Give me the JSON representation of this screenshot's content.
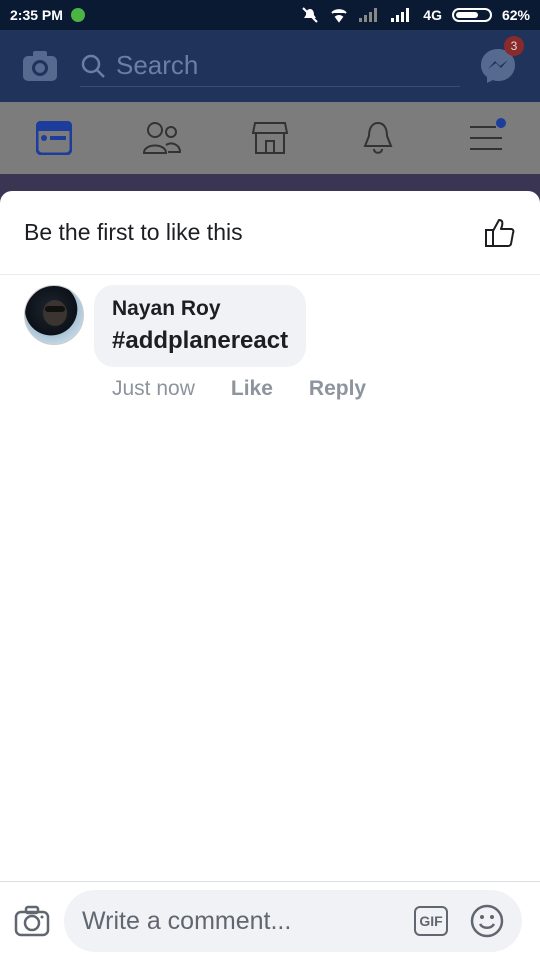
{
  "status_bar": {
    "time": "2:35 PM",
    "network": "4G",
    "battery": "62%"
  },
  "header": {
    "search_placeholder": "Search",
    "messenger_badge": "3"
  },
  "panel": {
    "likes_text": "Be the first to like this",
    "comment": {
      "author": "Nayan Roy",
      "text": "#addplanereact",
      "time": "Just now",
      "like_label": "Like",
      "reply_label": "Reply"
    }
  },
  "composer": {
    "placeholder": "Write a comment...",
    "gif_label": "GIF"
  },
  "colors": {
    "status_bg": "#0b1a33",
    "header_bg": "#20335a",
    "bubble_bg": "#f0f2f5",
    "muted_text": "#8d949e"
  }
}
